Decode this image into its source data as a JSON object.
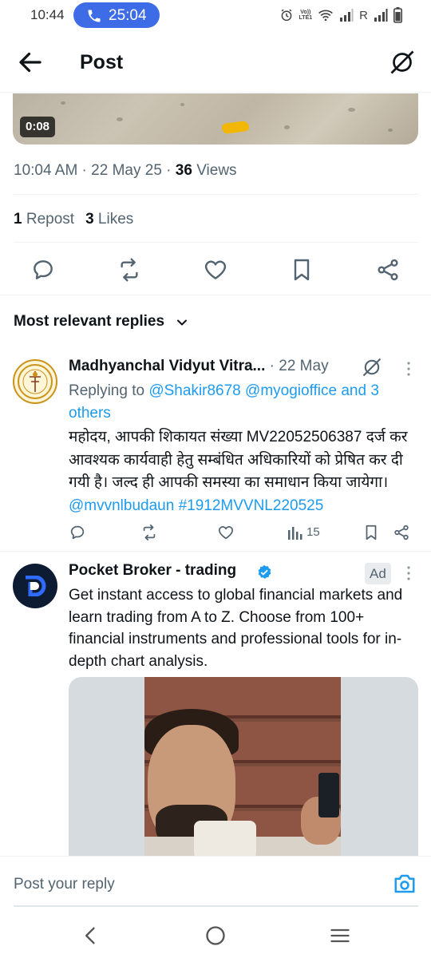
{
  "status_bar": {
    "time": "10:44",
    "call_timer": "25:04",
    "network_letter": "R",
    "lte_top": "Vo))",
    "lte_bottom": "LTE1"
  },
  "header": {
    "title": "Post"
  },
  "video": {
    "duration": "0:08"
  },
  "post_meta": {
    "time": "10:04 AM",
    "sep1": " · ",
    "date": "22 May 25",
    "sep2": " · ",
    "views_count": "36",
    "views_label": " Views"
  },
  "post_stats": {
    "reposts_count": "1",
    "reposts_label": " Repost",
    "likes_count": "3",
    "likes_label": " Likes"
  },
  "replies_section": {
    "title": "Most relevant replies"
  },
  "reply": {
    "author": "Madhyanchal Vidyut Vitra...",
    "date": " · 22 May",
    "replying_prefix": "Replying to ",
    "replying_handles": "@Shakir8678 @myogioffice and 3 others",
    "text": "महोदय, आपकी शिकायत संख्या MV22052506387 दर्ज कर आवश्यक कार्यवाही हेतु सम्बंधित अधिकारियों को प्रेषित कर दी गयी है। जल्द ही आपकी समस्या का समाधान किया जायेगा। ",
    "text_links": "@mvvnlbudaun #1912MVVNL220525",
    "views": "15"
  },
  "ad": {
    "author": "Pocket Broker - trading",
    "badge": "Ad",
    "text": "Get instant access to global financial markets and learn trading from A to Z. Choose from 100+ financial instruments and professional tools for in-depth chart analysis."
  },
  "composer": {
    "placeholder": "Post your reply"
  },
  "colors": {
    "accent": "#1d9bf0",
    "text_primary": "#0f1419",
    "text_secondary": "#536471",
    "call_pill": "#3d6ce6"
  }
}
